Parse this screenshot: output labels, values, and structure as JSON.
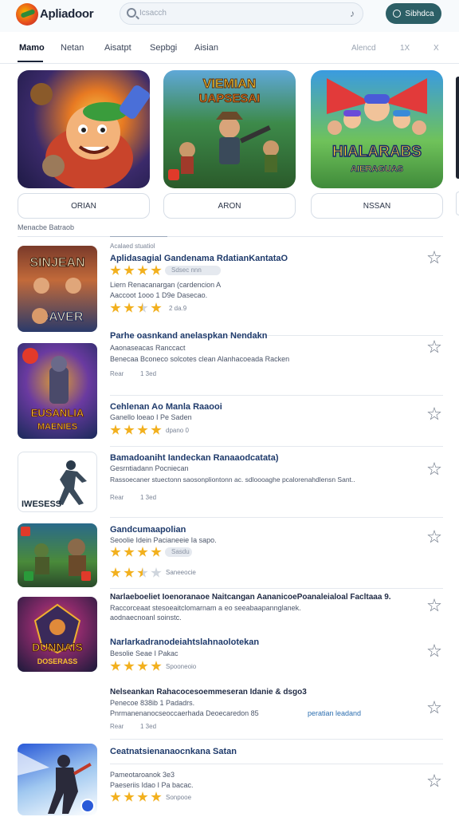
{
  "header": {
    "app_name": "Apliadoor",
    "search_placeholder": "Icsacch",
    "signin_label": "Sibhdca"
  },
  "tabs": [
    {
      "label": "Mamo"
    },
    {
      "label": "Netan"
    },
    {
      "label": "Aisatpt"
    },
    {
      "label": "Sepbgi"
    },
    {
      "label": "Aisian"
    }
  ],
  "tabs_right": {
    "label": "Alencd",
    "x1": "1X",
    "x2": "X"
  },
  "featured": [
    {
      "title": "",
      "button": "ORIAN"
    },
    {
      "title": "VIEMIAN UAPSESAI",
      "button": "ARON"
    },
    {
      "title": "HIALARABS AIERAGUAS",
      "button": "NSSAN"
    }
  ],
  "section_label": "Menacbe Batraob",
  "list": [
    {
      "overline": "Acalaed stuatiol",
      "title": "Aplidasagial Gandenama RdatianKantataO",
      "line1": "Liern Renacanargan (cardencion A",
      "line2": "Aaccoot 1ooo 1 D9e Dasecao.",
      "pill": "Sdsec nnn",
      "meta": "2 da.9",
      "thumb_text": "SINJEAN",
      "thumb_text2": "CAVER"
    },
    {
      "title": "Parhe oasnkand anelaspkan Nendakn",
      "line1": "Aaonaseacas Ranccact",
      "line2": "Benecaa Bconeco solcotes clean Alanhacoeada Racken",
      "meta": "1 3ed",
      "dl": "Rear",
      "thumb_text": "EUSANLIA",
      "thumb_text2": "MAENIES"
    },
    {
      "title": "Cehlenan Ao Manla Raaooi",
      "line1": "Ganello loeao I Pe Saden",
      "meta": "dpano 0"
    },
    {
      "title": "Bamadoaniht Iandeckan Ranaaodcatata)",
      "line1": "Gesrntiadann Pocniecan",
      "line2": "Rassoecaner stuectonn saosonpliontonn ac. sdloooaghe pcalorenahdlensn Sant..",
      "meta": "1 3ed",
      "dl": "Rear",
      "thumb_text": "IWESESS"
    },
    {
      "title": "Gandcumaapolian",
      "line1": "Seoolie Idein Pacianeeie Ia sapo.",
      "pill": "Sasdu",
      "meta": "Saneeocie"
    },
    {
      "title": "Narlaeboeliet Ioenoranaoe Naitcangan AananicoePoanaleialoal Facltaaa 9.",
      "line1": "Raccorceaat stesoeaitclomarnam a eo seeabaapannglanek.",
      "line2": "aodnaecnoanl soinstc.",
      "thumb_text": "DUNNAIS",
      "thumb_text2": "DOSERASS"
    },
    {
      "title": "Narlarkadranodeiahtslahnaolotekan",
      "line1": "Besolie Seae I Pakac",
      "meta": "Spooneoio"
    },
    {
      "title": "Nelseankan Rahacocesoemmeseran Idanie & dsgo3",
      "line1": "Penecoe 838ib 1 Padadrs.",
      "line2": "Pnrmanenanocseoccaerhada Deoecaredon 85",
      "link": "peratian leadand",
      "meta": "1 3ed",
      "dl": "Rear"
    },
    {
      "title": "Ceatnatsienanaocnkana Satan",
      "line1": "Pameotaroanok 3e3",
      "line2": "Paeseriis Idao I Pa bacac.",
      "meta": "Sonpooe"
    }
  ],
  "colors": {
    "accent": "#2c5f66",
    "star": "#f2b01e",
    "title": "#1e3a6b"
  }
}
